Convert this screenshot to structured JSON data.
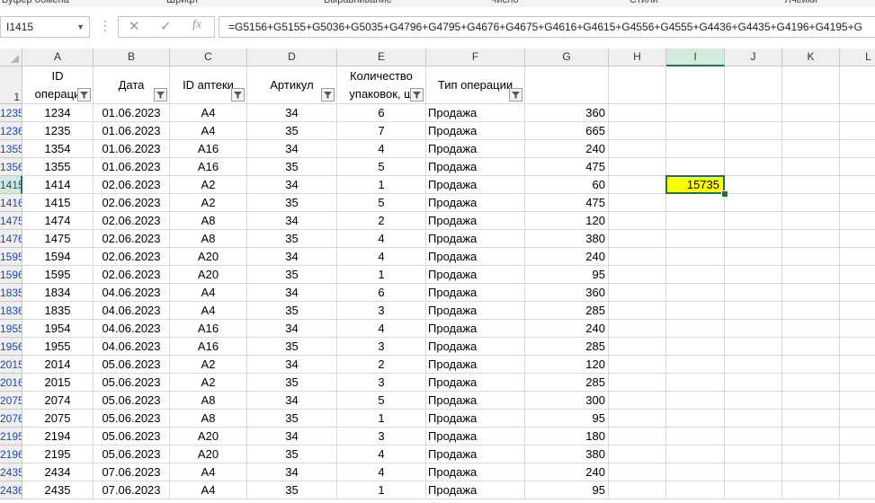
{
  "ribbon": {
    "groups": [
      "Буфер обмена",
      "Шрифт",
      "Выравнивание",
      "Число",
      "Стили",
      "Ячейки"
    ]
  },
  "formula_bar": {
    "name_box": "I1415",
    "formula": "=G5156+G5155+G5036+G5035+G4796+G4795+G4676+G4675+G4616+G4615+G4556+G4555+G4436+G4435+G4196+G4195+G",
    "cancel_glyph": "✕",
    "enter_glyph": "✓",
    "fx_glyph": "fx"
  },
  "grid": {
    "columns": [
      "A",
      "B",
      "C",
      "D",
      "E",
      "F",
      "G",
      "H",
      "I",
      "J",
      "K",
      "L"
    ],
    "selected_column": "I",
    "header_row_number": "1",
    "headers": {
      "A": {
        "line1": "ID",
        "line2": "операци"
      },
      "B": "Дата",
      "C": "ID аптеки",
      "D": "Артикул",
      "E": {
        "line1": "Количество",
        "line2": "упаковок, ш"
      },
      "F": "Тип операции",
      "G": ""
    },
    "rows": [
      {
        "num": "1235",
        "A": "1234",
        "B": "01.06.2023",
        "C": "A4",
        "D": "34",
        "E": "6",
        "F": "Продажа",
        "G": "360"
      },
      {
        "num": "1236",
        "A": "1235",
        "B": "01.06.2023",
        "C": "A4",
        "D": "35",
        "E": "7",
        "F": "Продажа",
        "G": "665"
      },
      {
        "num": "1355",
        "A": "1354",
        "B": "01.06.2023",
        "C": "A16",
        "D": "34",
        "E": "4",
        "F": "Продажа",
        "G": "240"
      },
      {
        "num": "1356",
        "A": "1355",
        "B": "01.06.2023",
        "C": "A16",
        "D": "35",
        "E": "5",
        "F": "Продажа",
        "G": "475"
      },
      {
        "num": "1415",
        "A": "1414",
        "B": "02.06.2023",
        "C": "A2",
        "D": "34",
        "E": "1",
        "F": "Продажа",
        "G": "60"
      },
      {
        "num": "1416",
        "A": "1415",
        "B": "02.06.2023",
        "C": "A2",
        "D": "35",
        "E": "5",
        "F": "Продажа",
        "G": "475"
      },
      {
        "num": "1475",
        "A": "1474",
        "B": "02.06.2023",
        "C": "A8",
        "D": "34",
        "E": "2",
        "F": "Продажа",
        "G": "120"
      },
      {
        "num": "1476",
        "A": "1475",
        "B": "02.06.2023",
        "C": "A8",
        "D": "35",
        "E": "4",
        "F": "Продажа",
        "G": "380"
      },
      {
        "num": "1595",
        "A": "1594",
        "B": "02.06.2023",
        "C": "A20",
        "D": "34",
        "E": "4",
        "F": "Продажа",
        "G": "240"
      },
      {
        "num": "1596",
        "A": "1595",
        "B": "02.06.2023",
        "C": "A20",
        "D": "35",
        "E": "1",
        "F": "Продажа",
        "G": "95"
      },
      {
        "num": "1835",
        "A": "1834",
        "B": "04.06.2023",
        "C": "A4",
        "D": "34",
        "E": "6",
        "F": "Продажа",
        "G": "360"
      },
      {
        "num": "1836",
        "A": "1835",
        "B": "04.06.2023",
        "C": "A4",
        "D": "35",
        "E": "3",
        "F": "Продажа",
        "G": "285"
      },
      {
        "num": "1955",
        "A": "1954",
        "B": "04.06.2023",
        "C": "A16",
        "D": "34",
        "E": "4",
        "F": "Продажа",
        "G": "240"
      },
      {
        "num": "1956",
        "A": "1955",
        "B": "04.06.2023",
        "C": "A16",
        "D": "35",
        "E": "3",
        "F": "Продажа",
        "G": "285"
      },
      {
        "num": "2015",
        "A": "2014",
        "B": "05.06.2023",
        "C": "A2",
        "D": "34",
        "E": "2",
        "F": "Продажа",
        "G": "120"
      },
      {
        "num": "2016",
        "A": "2015",
        "B": "05.06.2023",
        "C": "A2",
        "D": "35",
        "E": "3",
        "F": "Продажа",
        "G": "285"
      },
      {
        "num": "2075",
        "A": "2074",
        "B": "05.06.2023",
        "C": "A8",
        "D": "34",
        "E": "5",
        "F": "Продажа",
        "G": "300"
      },
      {
        "num": "2076",
        "A": "2075",
        "B": "05.06.2023",
        "C": "A8",
        "D": "35",
        "E": "1",
        "F": "Продажа",
        "G": "95"
      },
      {
        "num": "2195",
        "A": "2194",
        "B": "05.06.2023",
        "C": "A20",
        "D": "34",
        "E": "3",
        "F": "Продажа",
        "G": "180"
      },
      {
        "num": "2196",
        "A": "2195",
        "B": "05.06.2023",
        "C": "A20",
        "D": "35",
        "E": "4",
        "F": "Продажа",
        "G": "380"
      },
      {
        "num": "2435",
        "A": "2434",
        "B": "07.06.2023",
        "C": "A4",
        "D": "34",
        "E": "4",
        "F": "Продажа",
        "G": "240"
      },
      {
        "num": "2436",
        "A": "2435",
        "B": "07.06.2023",
        "C": "A4",
        "D": "35",
        "E": "1",
        "F": "Продажа",
        "G": "95"
      }
    ],
    "active_cell": {
      "ref": "I1415",
      "value": "15735",
      "fill_color": "#ffff00",
      "border_color": "#217346"
    }
  }
}
